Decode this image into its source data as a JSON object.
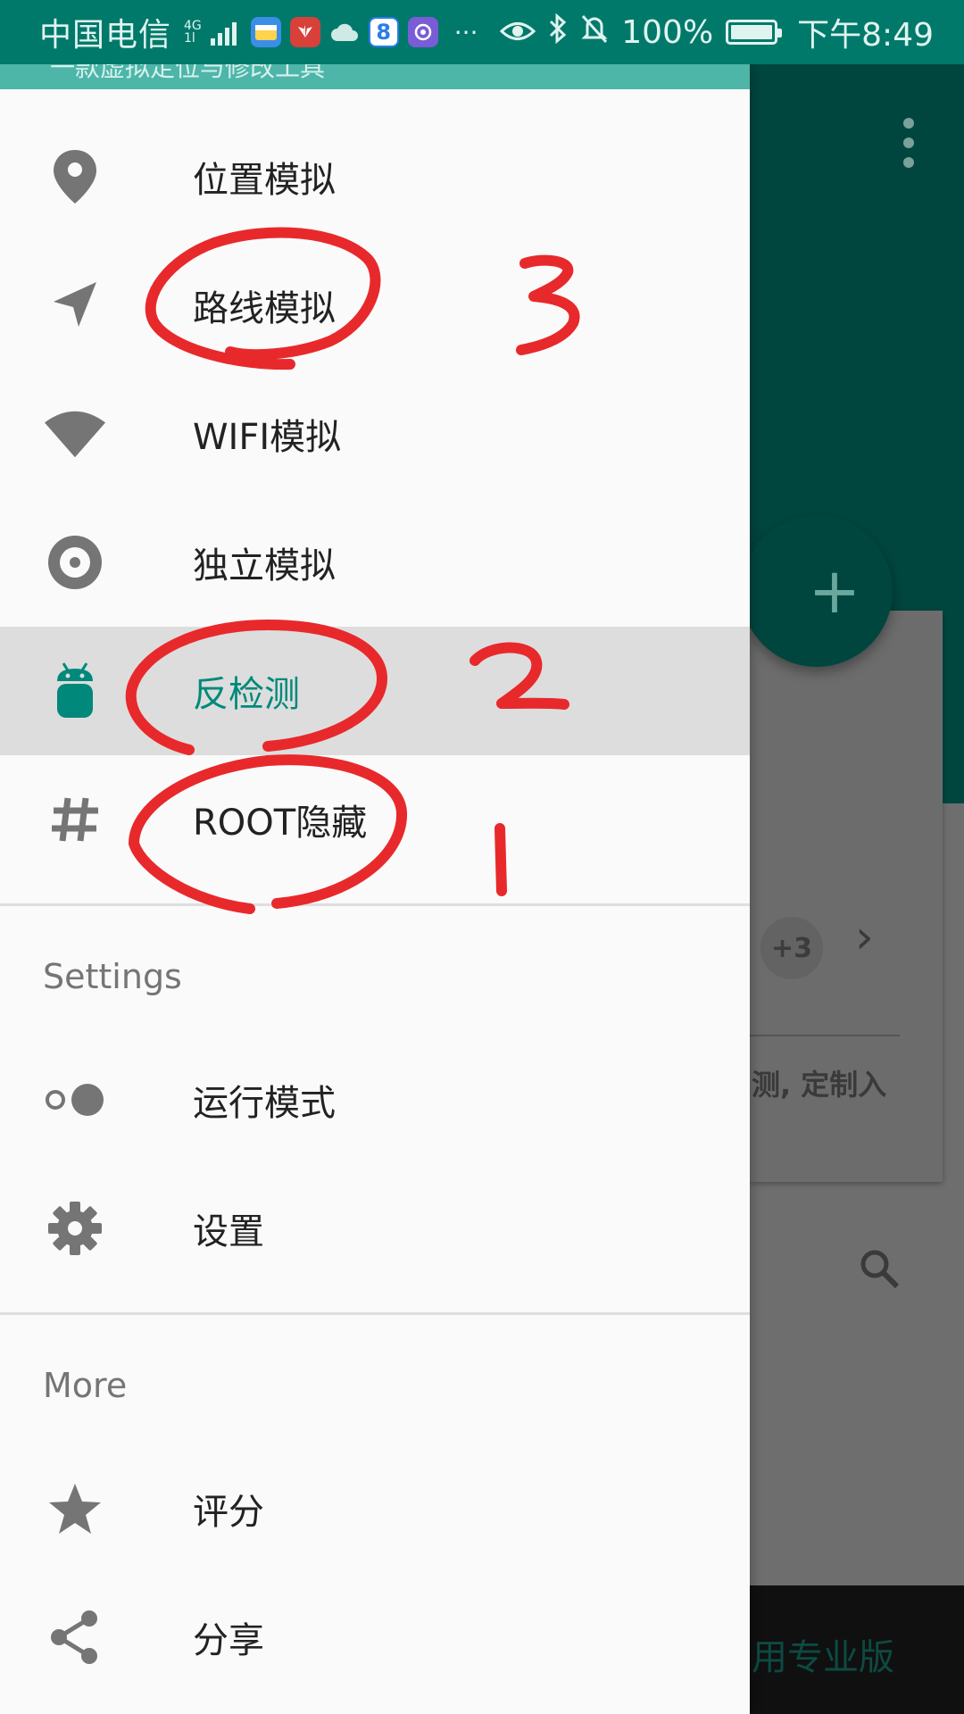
{
  "status_bar": {
    "carrier": "中国电信",
    "network": [
      "4G",
      "1l"
    ],
    "ellipsis": "···",
    "battery": "100%",
    "time": "下午8:49",
    "app_icon_8": "8"
  },
  "drawer": {
    "header_partial": "一款虚拟定位与修改工具",
    "items": [
      {
        "label": "位置模拟",
        "icon": "location-pin-icon"
      },
      {
        "label": "路线模拟",
        "icon": "navigation-arrow-icon"
      },
      {
        "label": "WIFI模拟",
        "icon": "wifi-icon"
      },
      {
        "label": "独立模拟",
        "icon": "disc-icon"
      },
      {
        "label": "反检测",
        "icon": "android-icon",
        "active": true
      },
      {
        "label": "ROOT隐藏",
        "icon": "hash-icon"
      }
    ],
    "settings_header": "Settings",
    "settings_items": [
      {
        "label": "运行模式",
        "icon": "toggle-mode-icon"
      },
      {
        "label": "设置",
        "icon": "gear-icon"
      }
    ],
    "more_header": "More",
    "more_items": [
      {
        "label": "评分",
        "icon": "star-icon"
      },
      {
        "label": "分享",
        "icon": "share-icon"
      }
    ]
  },
  "background": {
    "fab": "+",
    "chip": "+3",
    "chevron": "›",
    "card_text": "测, 定制入",
    "bottom_text": "用专业版"
  },
  "annotations": [
    "3",
    "2",
    "1"
  ],
  "colors": {
    "status_bar": "#00796b",
    "accent": "#00897b",
    "annotation": "#e8292b",
    "active_row": "#dddddd"
  }
}
